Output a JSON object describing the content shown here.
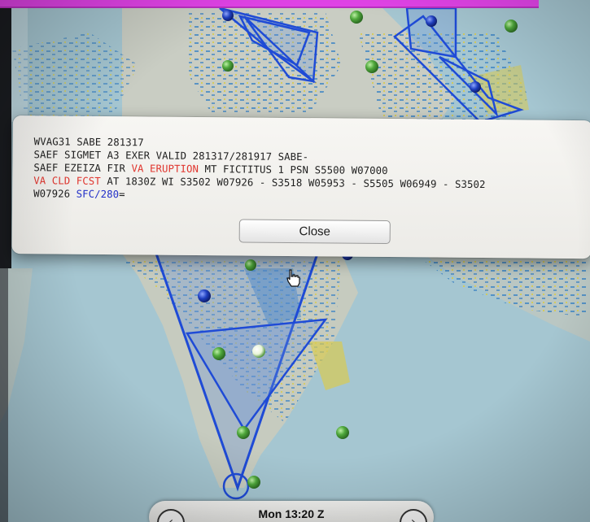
{
  "map": {
    "colors": {
      "water": "#9cc0cc",
      "land": "#c9cdc3",
      "radar_blue": "#3d84c4",
      "radar_yellow": "#d8cb52",
      "polygon_stroke": "#1f4bd6",
      "polygon_fill": "#6d96d8",
      "station_green": "#4fa83c",
      "station_blue": "#1f3fbf"
    },
    "features": [
      "sigmet-polygon",
      "volcanic-ash-forecast-polygon",
      "weather-stations",
      "radar-overlay"
    ]
  },
  "dialog": {
    "lines": [
      [
        {
          "t": "WVAG31 SABE 281317",
          "c": ""
        }
      ],
      [
        {
          "t": "SAEF SIGMET A3 EXER VALID 281317/281917 SABE-",
          "c": ""
        }
      ],
      [
        {
          "t": "SAEF EZEIZA FIR ",
          "c": ""
        },
        {
          "t": "VA ERUPTION",
          "c": "red"
        },
        {
          "t": " MT FICTITUS 1 PSN S5500 W07000",
          "c": ""
        }
      ],
      [
        {
          "t": "VA CLD FCST",
          "c": "red"
        },
        {
          "t": " AT 1830Z WI S3502 W07926 - S3518 W05953 - S5505 W06949 - S3502",
          "c": ""
        }
      ],
      [
        {
          "t": "W07926 ",
          "c": ""
        },
        {
          "t": "SFC/280",
          "c": "blue"
        },
        {
          "t": "=",
          "c": ""
        }
      ]
    ],
    "close_label": "Close"
  },
  "timebar": {
    "time_label": "Mon 13:20 Z",
    "prev_icon": "chevron-left-icon",
    "next_icon": "chevron-right-icon"
  }
}
